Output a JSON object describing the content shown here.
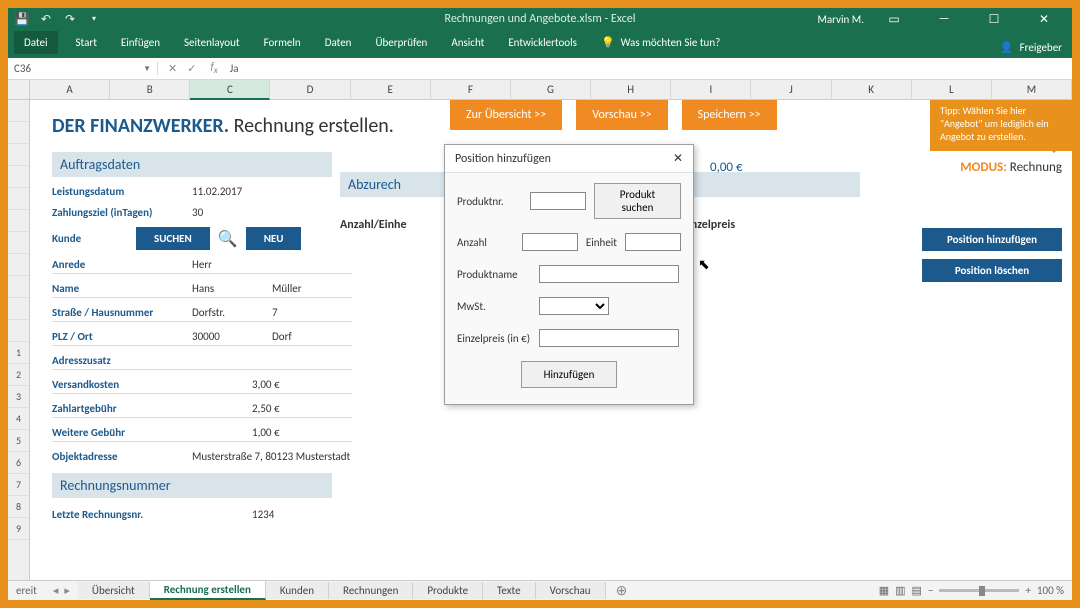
{
  "title": "Rechnungen und Angebote.xlsm  -  Excel",
  "user": "Marvin M.",
  "file_tab": "Datei",
  "ribbon": [
    "Start",
    "Einfügen",
    "Seitenlayout",
    "Formeln",
    "Daten",
    "Überprüfen",
    "Ansicht",
    "Entwicklertools"
  ],
  "tellme": "Was möchten Sie tun?",
  "share": "Freigeber",
  "namebox": "C36",
  "fx_value": "Ja",
  "columns": [
    "A",
    "B",
    "C",
    "D",
    "E",
    "F",
    "G",
    "H",
    "I",
    "J",
    "K",
    "L",
    "M"
  ],
  "rows": [
    "",
    "",
    "",
    "",
    "",
    "",
    "",
    "",
    "",
    "",
    "",
    "1",
    "2",
    "3",
    "4",
    "5",
    "6",
    "7",
    "8",
    "9"
  ],
  "heading_brand": "DER FINANZWERKER.",
  "heading_sub": "Rechnung erstellen.",
  "actions": {
    "overview": "Zur Übersicht >>",
    "preview": "Vorschau >>",
    "save": "Speichern >>"
  },
  "tip": "Tipp: Wählen Sie hier \"Angebot\" um lediglich ein Angebot zu erstellen.",
  "modus_label": "MODUS:",
  "modus_value": "Rechnung",
  "sections": {
    "auftragsdaten": "Auftragsdaten",
    "abzurechnen": "Abzurech",
    "rechnungsnummer": "Rechnungsnummer"
  },
  "amount": "0,00 €",
  "fields": {
    "leistungsdatum_k": "Leistungsdatum",
    "leistungsdatum_v": "11.02.2017",
    "zahlungsziel_k": "Zahlungsziel (inTagen)",
    "zahlungsziel_v": "30",
    "kunde_k": "Kunde",
    "suchen": "SUCHEN",
    "neu": "NEU",
    "anrede_k": "Anrede",
    "anrede_v": "Herr",
    "name_k": "Name",
    "name_v": "Hans",
    "name_v2": "Müller",
    "strasse_k": "Straße / Hausnummer",
    "strasse_v": "Dorfstr.",
    "strasse_v2": "7",
    "plz_k": "PLZ / Ort",
    "plz_v": "30000",
    "plz_v2": "Dorf",
    "adresszusatz_k": "Adresszusatz",
    "versand_k": "Versandkosten",
    "versand_v": "3,00 €",
    "zahlart_k": "Zahlartgebühr",
    "zahlart_v": "2,50 €",
    "weitere_k": "Weitere Gebühr",
    "weitere_v": "1,00 €",
    "objekt_k": "Objektadresse",
    "objekt_v": "Musterstraße 7, 80123 Musterstadt",
    "letzte_k": "Letzte Rechnungsnr.",
    "letzte_v": "1234"
  },
  "table_headers": {
    "anzahl_einheit": "Anzahl/Einhe",
    "einzelpreis": "Einzelpreis"
  },
  "pos_buttons": {
    "add": "Position hinzufügen",
    "del": "Position löschen"
  },
  "dialog": {
    "title": "Position hinzufügen",
    "produktnr": "Produktnr.",
    "produkt_suchen": "Produkt suchen",
    "anzahl": "Anzahl",
    "einheit": "Einheit",
    "produktname": "Produktname",
    "mwst": "MwSt.",
    "einzelpreis": "Einzelpreis (in €)",
    "hinzufuegen": "Hinzufügen"
  },
  "sheet_tabs": [
    "Übersicht",
    "Rechnung erstellen",
    "Kunden",
    "Rechnungen",
    "Produkte",
    "Texte",
    "Vorschau"
  ],
  "active_sheet_tab": 1,
  "status_ready": "ereit",
  "zoom": "100 %"
}
